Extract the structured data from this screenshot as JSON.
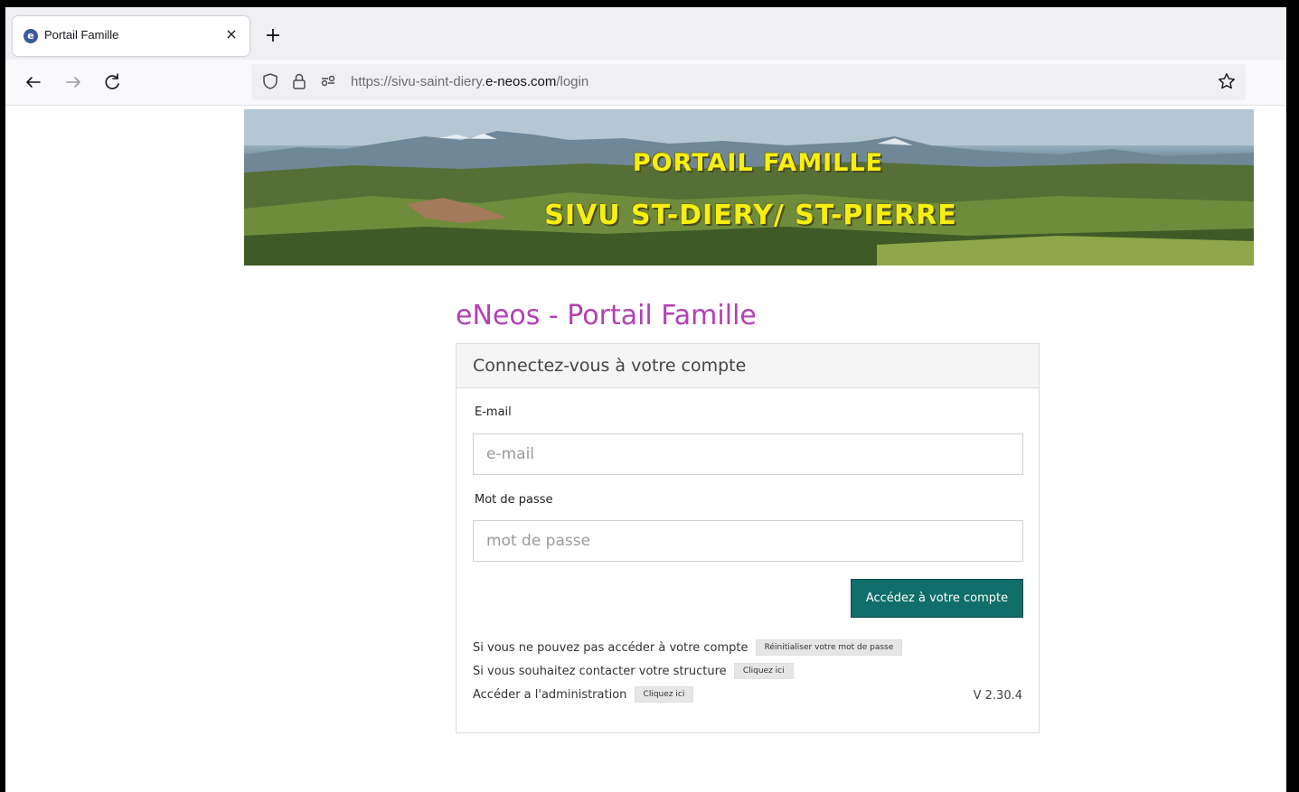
{
  "browser": {
    "tab_title": "Portail Famille",
    "tab_close": "×",
    "new_tab": "+",
    "url_prefix": "https://sivu-saint-diery.",
    "url_domain": "e-neos.com",
    "url_suffix": "/login"
  },
  "banner": {
    "line1": "PORTAIL FAMILLE",
    "line2": "SIVU ST-DIERY/ ST-PIERRE",
    "text_color": "#f7ef10"
  },
  "page": {
    "title": "eNeos - Portail Famille",
    "title_color": "#b43fb5"
  },
  "login": {
    "heading": "Connectez-vous à votre compte",
    "email_label": "E-mail",
    "email_placeholder": "e-mail",
    "password_label": "Mot de passe",
    "password_placeholder": "mot de passe",
    "submit_label": "Accédez à votre compte",
    "submit_color": "#0f6e6a"
  },
  "help": {
    "reset_text": "Si vous ne pouvez pas accéder à votre compte",
    "reset_button": "Réinitialiser votre mot de passe",
    "contact_text": "Si vous souhaitez contacter votre structure",
    "contact_button": "Cliquez ici",
    "admin_text": "Accéder a l'administration",
    "admin_button": "Cliquez ici"
  },
  "version": "V 2.30.4"
}
